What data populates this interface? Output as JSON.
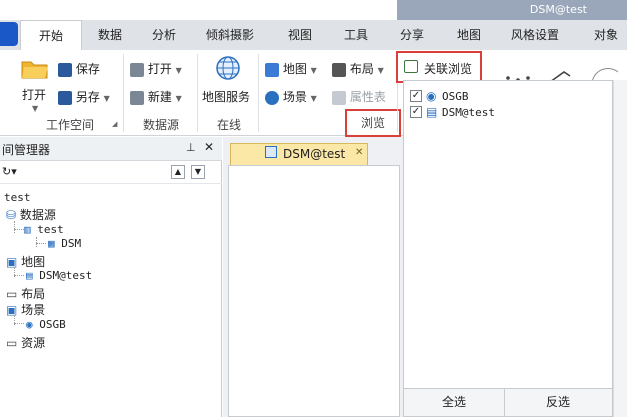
{
  "window": {
    "title": "DSM@test"
  },
  "tabs": [
    {
      "label": "开始"
    },
    {
      "label": "数据"
    },
    {
      "label": "分析"
    },
    {
      "label": "倾斜摄影"
    },
    {
      "label": "视图"
    },
    {
      "label": "工具"
    },
    {
      "label": "分享"
    },
    {
      "label": "地图"
    },
    {
      "label": "风格设置"
    },
    {
      "label": "对象"
    }
  ],
  "ribbon": {
    "workspace": {
      "open": "打开",
      "save": "保存",
      "save_as": "另存",
      "group": "工作空间"
    },
    "datasource": {
      "open": "打开",
      "new": "新建",
      "group": "数据源"
    },
    "online": {
      "map_service": "地图服务",
      "group": "在线"
    },
    "browse": {
      "map": "地图",
      "layout": "布局",
      "scene": "场景",
      "attr_table": "属性表",
      "linked_browse": "关联浏览",
      "group": "浏览"
    }
  },
  "workspace_manager": {
    "title": "工作空间管理器",
    "title_visible": "间管理器",
    "tree": {
      "root": "test",
      "datasources": "数据源",
      "ds_test": "test",
      "ds_dsm": "DSM",
      "maps": "地图",
      "map_dsm": "DSM@test",
      "layouts": "布局",
      "scenes": "场景",
      "scene_osgb": "OSGB",
      "resources": "资源"
    }
  },
  "document": {
    "tab_label": "DSM@test",
    "close": "✕"
  },
  "linked_panel": {
    "items": [
      {
        "label": "OSGB",
        "checked": true
      },
      {
        "label": "DSM@test",
        "checked": true
      }
    ],
    "select_all": "全选",
    "invert": "反选"
  }
}
